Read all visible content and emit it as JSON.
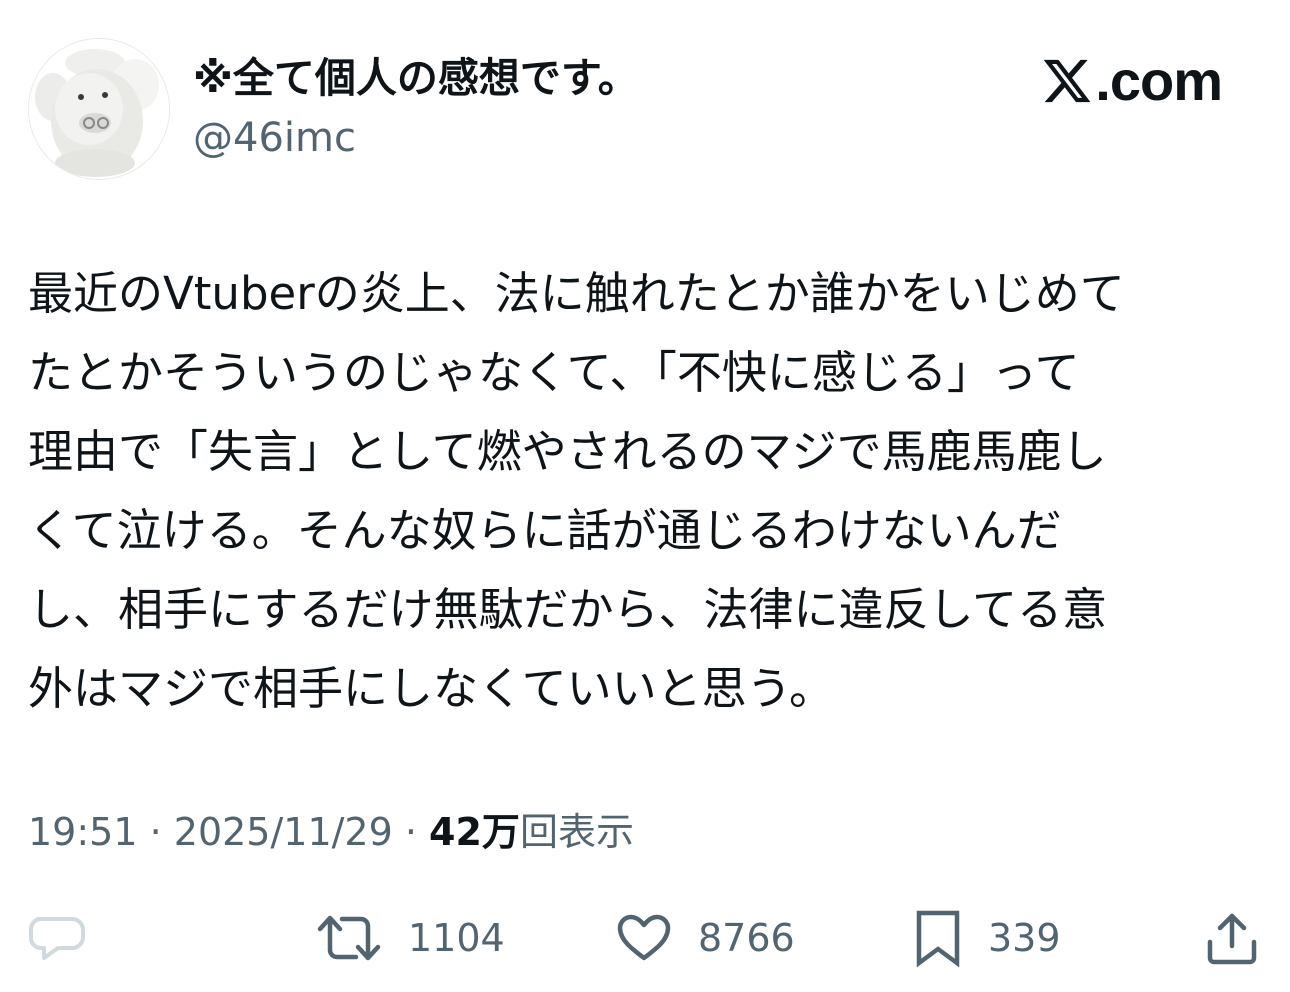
{
  "tweet": {
    "display_name": "※全て個人の感想です。",
    "handle": "@46imc",
    "avatar_icon": "avatar-image",
    "brand": {
      "icon": "x-logo-icon",
      "text": ".com"
    },
    "text_lines": [
      "最近のVtuberの炎上、法に触れたとか誰かをいじめて",
      "たとかそういうのじゃなくて、「不快に感じる」って",
      "理由で「失言」として燃やされるのマジで馬鹿馬鹿し",
      "くて泣ける。そんな奴らに話が通じるわけないんだ",
      "し、相手にするだけ無駄だから、法律に違反してる意",
      "外はマジで相手にしなくていいと思う。"
    ],
    "meta": {
      "time": "19:51",
      "separator": " · ",
      "date": "2025/11/29",
      "views_count": "42万",
      "views_label": "回表示"
    },
    "actions": {
      "reply": {
        "icon": "reply-icon",
        "count": ""
      },
      "retweet": {
        "icon": "retweet-icon",
        "count": "1104"
      },
      "like": {
        "icon": "heart-icon",
        "count": "8766"
      },
      "bookmark": {
        "icon": "bookmark-icon",
        "count": "339"
      },
      "share": {
        "icon": "share-icon",
        "count": ""
      }
    }
  },
  "colors": {
    "text_primary": "#0f1419",
    "text_secondary": "#536471",
    "reply_icon": "#cfd9de",
    "border": "#e6e9eb"
  }
}
